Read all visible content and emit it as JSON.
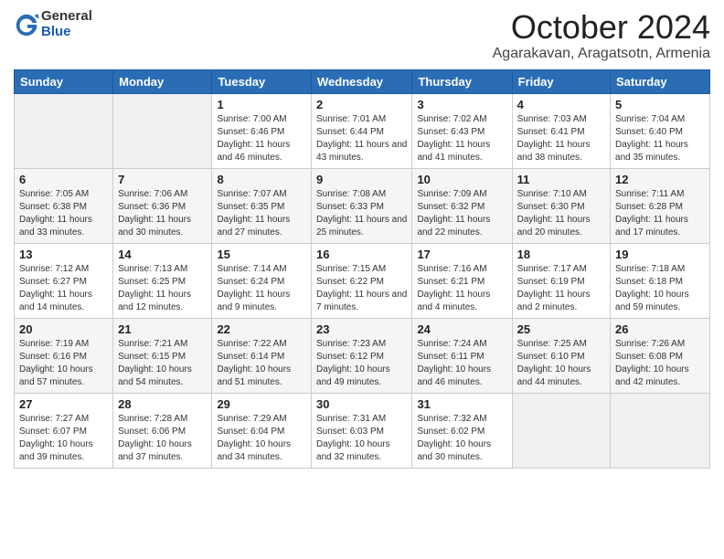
{
  "logo": {
    "general": "General",
    "blue": "Blue"
  },
  "title": "October 2024",
  "location": "Agarakavan, Aragatsotn, Armenia",
  "days_of_week": [
    "Sunday",
    "Monday",
    "Tuesday",
    "Wednesday",
    "Thursday",
    "Friday",
    "Saturday"
  ],
  "weeks": [
    [
      {
        "day": "",
        "sunrise": "",
        "sunset": "",
        "daylight": "",
        "empty": true
      },
      {
        "day": "",
        "sunrise": "",
        "sunset": "",
        "daylight": "",
        "empty": true
      },
      {
        "day": "1",
        "sunrise": "Sunrise: 7:00 AM",
        "sunset": "Sunset: 6:46 PM",
        "daylight": "Daylight: 11 hours and 46 minutes."
      },
      {
        "day": "2",
        "sunrise": "Sunrise: 7:01 AM",
        "sunset": "Sunset: 6:44 PM",
        "daylight": "Daylight: 11 hours and 43 minutes."
      },
      {
        "day": "3",
        "sunrise": "Sunrise: 7:02 AM",
        "sunset": "Sunset: 6:43 PM",
        "daylight": "Daylight: 11 hours and 41 minutes."
      },
      {
        "day": "4",
        "sunrise": "Sunrise: 7:03 AM",
        "sunset": "Sunset: 6:41 PM",
        "daylight": "Daylight: 11 hours and 38 minutes."
      },
      {
        "day": "5",
        "sunrise": "Sunrise: 7:04 AM",
        "sunset": "Sunset: 6:40 PM",
        "daylight": "Daylight: 11 hours and 35 minutes."
      }
    ],
    [
      {
        "day": "6",
        "sunrise": "Sunrise: 7:05 AM",
        "sunset": "Sunset: 6:38 PM",
        "daylight": "Daylight: 11 hours and 33 minutes."
      },
      {
        "day": "7",
        "sunrise": "Sunrise: 7:06 AM",
        "sunset": "Sunset: 6:36 PM",
        "daylight": "Daylight: 11 hours and 30 minutes."
      },
      {
        "day": "8",
        "sunrise": "Sunrise: 7:07 AM",
        "sunset": "Sunset: 6:35 PM",
        "daylight": "Daylight: 11 hours and 27 minutes."
      },
      {
        "day": "9",
        "sunrise": "Sunrise: 7:08 AM",
        "sunset": "Sunset: 6:33 PM",
        "daylight": "Daylight: 11 hours and 25 minutes."
      },
      {
        "day": "10",
        "sunrise": "Sunrise: 7:09 AM",
        "sunset": "Sunset: 6:32 PM",
        "daylight": "Daylight: 11 hours and 22 minutes."
      },
      {
        "day": "11",
        "sunrise": "Sunrise: 7:10 AM",
        "sunset": "Sunset: 6:30 PM",
        "daylight": "Daylight: 11 hours and 20 minutes."
      },
      {
        "day": "12",
        "sunrise": "Sunrise: 7:11 AM",
        "sunset": "Sunset: 6:28 PM",
        "daylight": "Daylight: 11 hours and 17 minutes."
      }
    ],
    [
      {
        "day": "13",
        "sunrise": "Sunrise: 7:12 AM",
        "sunset": "Sunset: 6:27 PM",
        "daylight": "Daylight: 11 hours and 14 minutes."
      },
      {
        "day": "14",
        "sunrise": "Sunrise: 7:13 AM",
        "sunset": "Sunset: 6:25 PM",
        "daylight": "Daylight: 11 hours and 12 minutes."
      },
      {
        "day": "15",
        "sunrise": "Sunrise: 7:14 AM",
        "sunset": "Sunset: 6:24 PM",
        "daylight": "Daylight: 11 hours and 9 minutes."
      },
      {
        "day": "16",
        "sunrise": "Sunrise: 7:15 AM",
        "sunset": "Sunset: 6:22 PM",
        "daylight": "Daylight: 11 hours and 7 minutes."
      },
      {
        "day": "17",
        "sunrise": "Sunrise: 7:16 AM",
        "sunset": "Sunset: 6:21 PM",
        "daylight": "Daylight: 11 hours and 4 minutes."
      },
      {
        "day": "18",
        "sunrise": "Sunrise: 7:17 AM",
        "sunset": "Sunset: 6:19 PM",
        "daylight": "Daylight: 11 hours and 2 minutes."
      },
      {
        "day": "19",
        "sunrise": "Sunrise: 7:18 AM",
        "sunset": "Sunset: 6:18 PM",
        "daylight": "Daylight: 10 hours and 59 minutes."
      }
    ],
    [
      {
        "day": "20",
        "sunrise": "Sunrise: 7:19 AM",
        "sunset": "Sunset: 6:16 PM",
        "daylight": "Daylight: 10 hours and 57 minutes."
      },
      {
        "day": "21",
        "sunrise": "Sunrise: 7:21 AM",
        "sunset": "Sunset: 6:15 PM",
        "daylight": "Daylight: 10 hours and 54 minutes."
      },
      {
        "day": "22",
        "sunrise": "Sunrise: 7:22 AM",
        "sunset": "Sunset: 6:14 PM",
        "daylight": "Daylight: 10 hours and 51 minutes."
      },
      {
        "day": "23",
        "sunrise": "Sunrise: 7:23 AM",
        "sunset": "Sunset: 6:12 PM",
        "daylight": "Daylight: 10 hours and 49 minutes."
      },
      {
        "day": "24",
        "sunrise": "Sunrise: 7:24 AM",
        "sunset": "Sunset: 6:11 PM",
        "daylight": "Daylight: 10 hours and 46 minutes."
      },
      {
        "day": "25",
        "sunrise": "Sunrise: 7:25 AM",
        "sunset": "Sunset: 6:10 PM",
        "daylight": "Daylight: 10 hours and 44 minutes."
      },
      {
        "day": "26",
        "sunrise": "Sunrise: 7:26 AM",
        "sunset": "Sunset: 6:08 PM",
        "daylight": "Daylight: 10 hours and 42 minutes."
      }
    ],
    [
      {
        "day": "27",
        "sunrise": "Sunrise: 7:27 AM",
        "sunset": "Sunset: 6:07 PM",
        "daylight": "Daylight: 10 hours and 39 minutes."
      },
      {
        "day": "28",
        "sunrise": "Sunrise: 7:28 AM",
        "sunset": "Sunset: 6:06 PM",
        "daylight": "Daylight: 10 hours and 37 minutes."
      },
      {
        "day": "29",
        "sunrise": "Sunrise: 7:29 AM",
        "sunset": "Sunset: 6:04 PM",
        "daylight": "Daylight: 10 hours and 34 minutes."
      },
      {
        "day": "30",
        "sunrise": "Sunrise: 7:31 AM",
        "sunset": "Sunset: 6:03 PM",
        "daylight": "Daylight: 10 hours and 32 minutes."
      },
      {
        "day": "31",
        "sunrise": "Sunrise: 7:32 AM",
        "sunset": "Sunset: 6:02 PM",
        "daylight": "Daylight: 10 hours and 30 minutes."
      },
      {
        "day": "",
        "sunrise": "",
        "sunset": "",
        "daylight": "",
        "empty": true
      },
      {
        "day": "",
        "sunrise": "",
        "sunset": "",
        "daylight": "",
        "empty": true
      }
    ]
  ]
}
